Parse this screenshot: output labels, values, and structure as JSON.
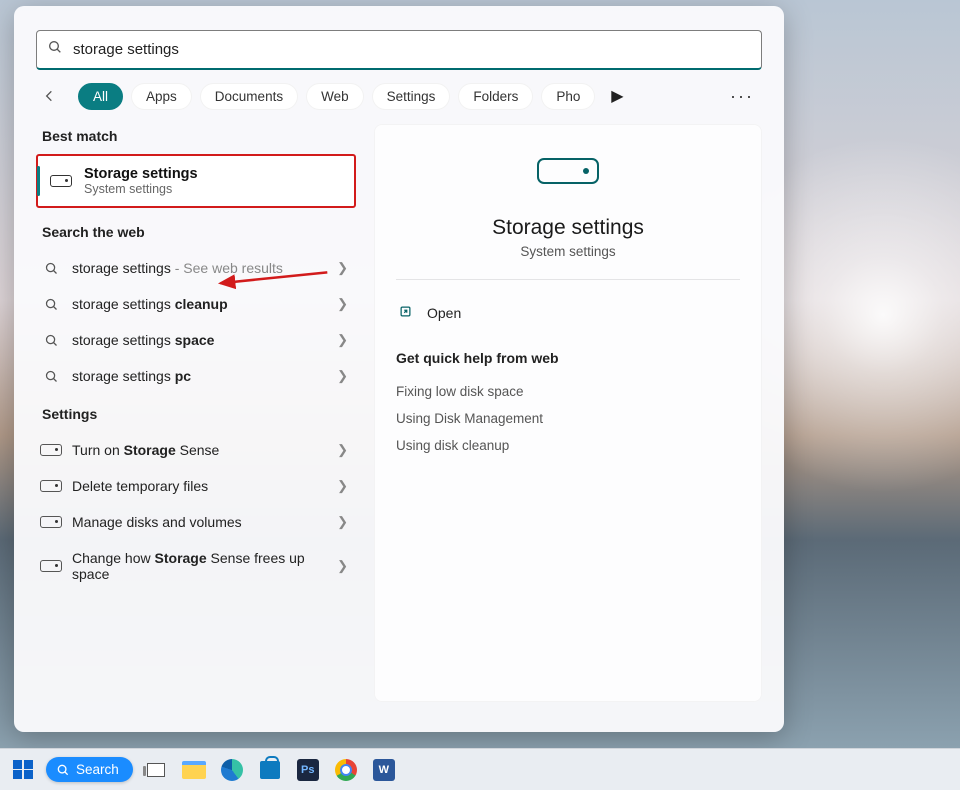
{
  "search": {
    "query": "storage settings"
  },
  "tabs": {
    "items": [
      "All",
      "Apps",
      "Documents",
      "Web",
      "Settings",
      "Folders",
      "Pho"
    ],
    "active_index": 0
  },
  "left": {
    "best_match_heading": "Best match",
    "best_match": {
      "title": "Storage settings",
      "subtitle": "System settings"
    },
    "web_heading": "Search the web",
    "web_results": [
      {
        "prefix": "storage settings",
        "suffix": " - See web results",
        "muted_suffix": true
      },
      {
        "prefix": "storage settings ",
        "bold": "cleanup"
      },
      {
        "prefix": "storage settings ",
        "bold": "space"
      },
      {
        "prefix": "storage settings ",
        "bold": "pc"
      }
    ],
    "settings_heading": "Settings",
    "settings_results": [
      {
        "pre": "Turn on ",
        "bold": "Storage",
        "post": " Sense"
      },
      {
        "pre": "Delete temporary files"
      },
      {
        "pre": "Manage disks and volumes"
      },
      {
        "pre": "Change how ",
        "bold": "Storage",
        "post": " Sense frees up space"
      }
    ]
  },
  "right": {
    "title": "Storage settings",
    "subtitle": "System settings",
    "open_label": "Open",
    "help_heading": "Get quick help from web",
    "help_links": [
      "Fixing low disk space",
      "Using Disk Management",
      "Using disk cleanup"
    ]
  },
  "taskbar": {
    "search_label": "Search"
  }
}
